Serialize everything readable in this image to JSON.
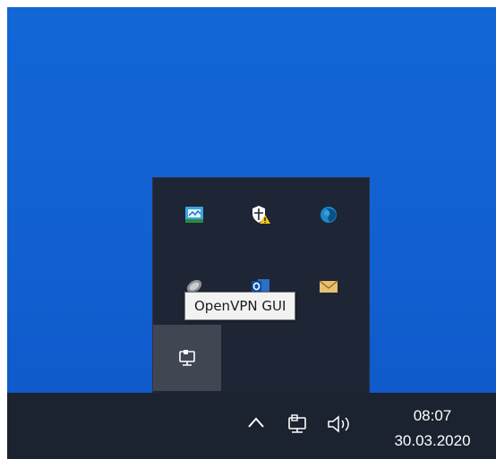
{
  "tooltip": {
    "text": "OpenVPN GUI"
  },
  "tray_icons": [
    {
      "name": "monitor-app-icon",
      "state": "normal"
    },
    {
      "name": "security-shield-warning-icon",
      "state": "warning"
    },
    {
      "name": "blue-globe-icon",
      "state": "normal"
    },
    {
      "name": "satellite-dish-icon",
      "state": "normal"
    },
    {
      "name": "outlook-icon",
      "state": "normal"
    },
    {
      "name": "envelope-icon",
      "state": "normal"
    },
    {
      "name": "openvpn-network-icon",
      "state": "hovered"
    }
  ],
  "taskbar": {
    "time": "08:07",
    "date": "30.03.2020",
    "icons": [
      "chevron-up-icon",
      "network-icon",
      "volume-icon"
    ]
  },
  "colors": {
    "desktop": "#1266d6",
    "flyout": "#1e2535",
    "taskbar": "#1b2230",
    "tooltip_bg": "#f2f2f2",
    "hover_cell": "#404652"
  }
}
